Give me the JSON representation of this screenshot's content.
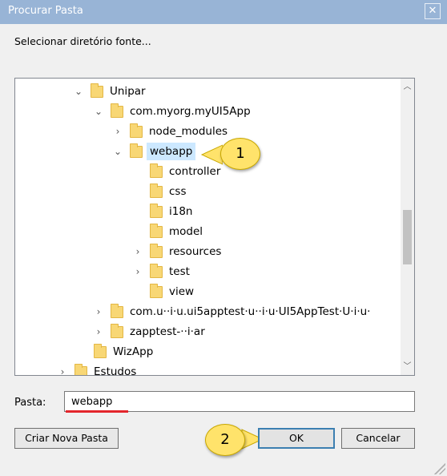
{
  "window": {
    "title": "Procurar Pasta",
    "close_glyph": "✕"
  },
  "subtitle": "Selecionar diretório fonte...",
  "tree": {
    "items": [
      {
        "label": "Unipar",
        "chev": "⌄"
      },
      {
        "label": "com.myorg.myUI5App",
        "chev": "⌄"
      },
      {
        "label": "node_modules",
        "chev": "›"
      },
      {
        "label": "webapp",
        "chev": "⌄"
      },
      {
        "label": "controller",
        "chev": ""
      },
      {
        "label": "css",
        "chev": ""
      },
      {
        "label": "i18n",
        "chev": ""
      },
      {
        "label": "model",
        "chev": ""
      },
      {
        "label": "resources",
        "chev": "›"
      },
      {
        "label": "test",
        "chev": "›"
      },
      {
        "label": "view",
        "chev": ""
      },
      {
        "label": "com.u··i·u.ui5apptest·u··i·u·UI5AppTest·U·i·u·",
        "chev": "›"
      },
      {
        "label": "zapptest-··i·ar",
        "chev": "›"
      },
      {
        "label": "WizApp",
        "chev": ""
      },
      {
        "label": "Estudos",
        "chev": "›"
      }
    ],
    "selected": "webapp"
  },
  "callouts": {
    "one": "1",
    "two": "2"
  },
  "pasta": {
    "label": "Pasta:",
    "value": "webapp"
  },
  "buttons": {
    "new_folder": "Criar Nova Pasta",
    "ok": "OK",
    "cancel": "Cancelar"
  },
  "colors": {
    "titlebar": "#98b4d6",
    "selection": "#cce8ff",
    "folder": "#f8d775",
    "callout": "#ffe36b",
    "underline": "#e3262c"
  }
}
